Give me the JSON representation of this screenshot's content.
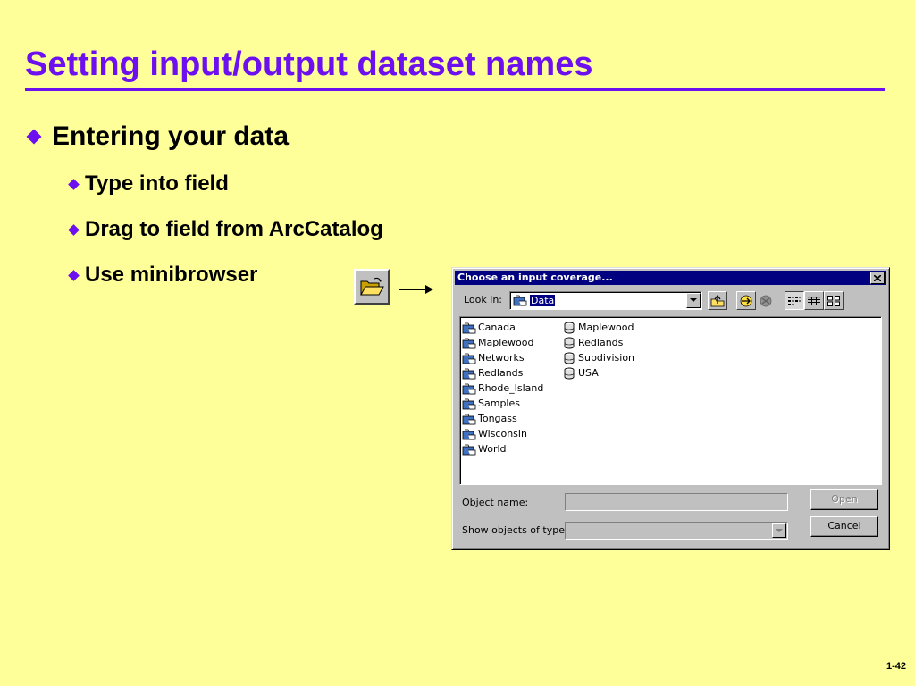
{
  "slide": {
    "title": "Setting input/output dataset names",
    "bullet_main": "Entering your data",
    "sub_bullets": [
      "Type into field",
      "Drag to field from ArcCatalog",
      "Use minibrowser"
    ],
    "page_number": "1-42",
    "accent_color": "#6d10ef",
    "background_color": "#ffff99"
  },
  "minibrowser_button": {
    "icon": "open-folder-icon"
  },
  "dialog": {
    "title": "Choose an input coverage...",
    "look_in_label": "Look in:",
    "look_in_value": "Data",
    "toolbar_icons": [
      "up-one-level-icon",
      "connect-folder-icon",
      "disconnect-folder-icon",
      "list-view-icon",
      "details-view-icon",
      "thumbnails-view-icon"
    ],
    "items_col1": [
      "Canada",
      "Maplewood",
      "Networks",
      "Redlands",
      "Rhode_Island",
      "Samples",
      "Tongass",
      "Wisconsin",
      "World"
    ],
    "items_col2": [
      "Maplewood",
      "Redlands",
      "Subdivision",
      "USA"
    ],
    "object_name_label": "Object name:",
    "object_name_value": "",
    "show_type_label": "Show objects of type:",
    "show_type_value": "",
    "open_button": "Open",
    "cancel_button": "Cancel",
    "title_bar_color": "#000080"
  }
}
